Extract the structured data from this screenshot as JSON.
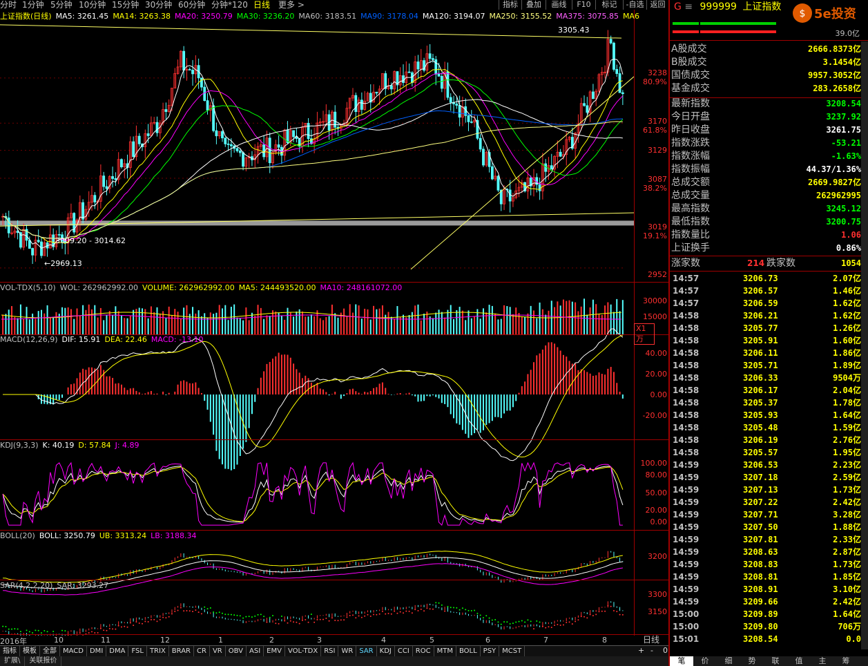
{
  "toolbar": {
    "periods": [
      "分时",
      "1分钟",
      "5分钟",
      "10分钟",
      "15分钟",
      "30分钟",
      "60分钟",
      "分钟*120",
      "日线",
      "更多 >"
    ],
    "active_period": "日线",
    "buttons": [
      "指标",
      "叠加",
      "画线",
      "F10",
      "标记",
      "-自选",
      "返回"
    ]
  },
  "main_chart": {
    "title": "上证指数(日线)",
    "ma_labels": [
      {
        "text": "MA5: 3261.45",
        "color": "#ffffff"
      },
      {
        "text": "MA14: 3263.38",
        "color": "#ffff00"
      },
      {
        "text": "MA20: 3250.79",
        "color": "#ff00ff"
      },
      {
        "text": "MA30: 3236.20",
        "color": "#00ff00"
      },
      {
        "text": "MA60: 3183.51",
        "color": "#c0c0c0"
      },
      {
        "text": "MA90: 3178.04",
        "color": "#0060ff"
      },
      {
        "text": "MA120: 3194.07",
        "color": "#ffffff"
      },
      {
        "text": "MA250: 3155.52",
        "color": "#ffff80"
      },
      {
        "text": "MA375: 3075.85",
        "color": "#ff60ff"
      },
      {
        "text": "MA6",
        "color": "#ffff00"
      }
    ],
    "annotations": [
      "3305.43",
      "3009.20 - 3014.62",
      "2969.13"
    ],
    "y_labels": [
      "3238",
      "80.9%",
      "3170",
      "61.8%",
      "3129",
      "3087",
      "38.2%",
      "3019",
      "19.1%",
      "2952"
    ]
  },
  "vol_panel": {
    "title": "VOL-TDX(5,10)",
    "labels": [
      {
        "text": "VOL-TDX(5,10)",
        "color": "#c0c0c0"
      },
      {
        "text": "WOL: 262962992.00",
        "color": "#c0c0c0"
      },
      {
        "text": "VOLUME: 262962992.00",
        "color": "#ffff00"
      },
      {
        "text": "MA5: 244493520.00",
        "color": "#ffff00"
      },
      {
        "text": "MA10: 248161072.00",
        "color": "#ff00ff"
      }
    ],
    "y_labels": [
      "30000",
      "15000",
      "X1万"
    ]
  },
  "macd_panel": {
    "labels": [
      {
        "text": "MACD(12,26,9)",
        "color": "#c0c0c0"
      },
      {
        "text": "DIF: 15.91",
        "color": "#ffffff"
      },
      {
        "text": "DEA: 22.46",
        "color": "#ffff00"
      },
      {
        "text": "MACD: -13.10",
        "color": "#ff00ff"
      }
    ],
    "y_labels": [
      "40.00",
      "20.00",
      "0.00",
      "-20.00"
    ]
  },
  "kdj_panel": {
    "labels": [
      {
        "text": "KDJ(9,3,3)",
        "color": "#c0c0c0"
      },
      {
        "text": "K: 40.19",
        "color": "#ffffff"
      },
      {
        "text": "D: 57.84",
        "color": "#ffff00"
      },
      {
        "text": "J: 4.89",
        "color": "#ff00ff"
      }
    ],
    "y_labels": [
      "100.00",
      "80.00",
      "50.00",
      "20.00",
      "0.00"
    ]
  },
  "boll_panel": {
    "labels": [
      {
        "text": "BOLL(20)",
        "color": "#c0c0c0"
      },
      {
        "text": "BOLL: 3250.79",
        "color": "#ffffff"
      },
      {
        "text": "UB: 3313.24",
        "color": "#ffff00"
      },
      {
        "text": "LB: 3188.34",
        "color": "#ff00ff"
      }
    ],
    "y_labels": [
      "3200"
    ]
  },
  "sar_panel": {
    "labels": [
      {
        "text": "SAR(4,2,2,20)",
        "color": "#c0c0c0"
      },
      {
        "text": "SAR: 3293.27",
        "color": "#c0c0c0"
      }
    ],
    "y_labels": [
      "3300",
      "3150"
    ]
  },
  "x_axis": {
    "labels": [
      "2016年",
      "10",
      "11",
      "12",
      "1",
      "2",
      "3",
      "4",
      "5",
      "6",
      "7",
      "8"
    ],
    "period_button": "日线"
  },
  "tabs": [
    "指标",
    "模板",
    "全部",
    "MACD",
    "DMI",
    "DMA",
    "FSL",
    "TRIX",
    "BRAR",
    "CR",
    "VR",
    "OBV",
    "ASI",
    "EMV",
    "VOL-TDX",
    "RSI",
    "WR",
    "SAR",
    "KDJ",
    "CCI",
    "ROC",
    "MTM",
    "BOLL",
    "PSY",
    "MCST"
  ],
  "active_tab": "SAR",
  "page_buttons": [
    "+",
    "-",
    "0"
  ],
  "bottom_bar": [
    "扩展\\",
    "关联报价"
  ],
  "right_panel": {
    "g_label": "G",
    "code": "999999",
    "name": "上证指数",
    "logo_text": "5e投资",
    "ratio": "39.0亿",
    "stats": [
      {
        "label": "A股成交",
        "value": "2666.8373亿",
        "color": "#ffff00"
      },
      {
        "label": "B股成交",
        "value": "3.1454亿",
        "color": "#ffff00"
      },
      {
        "label": "国债成交",
        "value": "9957.3052亿",
        "color": "#ffff00"
      },
      {
        "label": "基金成交",
        "value": "283.2658亿",
        "color": "#ffff00"
      }
    ],
    "quote": [
      {
        "label": "最新指数",
        "value": "3208.54",
        "color": "#00ff00"
      },
      {
        "label": "今日开盘",
        "value": "3237.92",
        "color": "#00ff00"
      },
      {
        "label": "昨日收盘",
        "value": "3261.75",
        "color": "#ffffff"
      },
      {
        "label": "指数涨跌",
        "value": "-53.21",
        "color": "#00ff00"
      },
      {
        "label": "指数涨幅",
        "value": "-1.63%",
        "color": "#00ff00"
      },
      {
        "label": "指数振幅",
        "value": "44.37/1.36%",
        "color": "#ffffff"
      },
      {
        "label": "总成交额",
        "value": "2669.9827亿",
        "color": "#ffff00"
      },
      {
        "label": "总成交量",
        "value": "262962995",
        "color": "#ffff00"
      },
      {
        "label": "最高指数",
        "value": "3245.12",
        "color": "#00ff00"
      },
      {
        "label": "最低指数",
        "value": "3200.75",
        "color": "#00ff00"
      },
      {
        "label": "指数量比",
        "value": "1.06",
        "color": "#ff3030"
      },
      {
        "label": "上证换手",
        "value": "0.86%",
        "color": "#ffffff"
      }
    ],
    "advance_label": "涨家数",
    "advance_value": "214",
    "decline_label": "跌家数",
    "decline_value": "1054",
    "ticks": [
      {
        "time": "14:57",
        "price": "3206.73",
        "vol": "2.07亿"
      },
      {
        "time": "14:57",
        "price": "3206.57",
        "vol": "1.46亿"
      },
      {
        "time": "14:57",
        "price": "3206.59",
        "vol": "1.62亿"
      },
      {
        "time": "14:58",
        "price": "3206.21",
        "vol": "1.62亿"
      },
      {
        "time": "14:58",
        "price": "3205.77",
        "vol": "1.26亿"
      },
      {
        "time": "14:58",
        "price": "3205.91",
        "vol": "1.60亿"
      },
      {
        "time": "14:58",
        "price": "3206.11",
        "vol": "1.86亿"
      },
      {
        "time": "14:58",
        "price": "3205.71",
        "vol": "1.89亿"
      },
      {
        "time": "14:58",
        "price": "3206.33",
        "vol": "9504万"
      },
      {
        "time": "14:58",
        "price": "3206.17",
        "vol": "2.04亿"
      },
      {
        "time": "14:58",
        "price": "3205.37",
        "vol": "1.78亿"
      },
      {
        "time": "14:58",
        "price": "3205.93",
        "vol": "1.64亿"
      },
      {
        "time": "14:58",
        "price": "3205.48",
        "vol": "1.59亿"
      },
      {
        "time": "14:58",
        "price": "3206.19",
        "vol": "2.76亿"
      },
      {
        "time": "14:58",
        "price": "3205.57",
        "vol": "1.95亿"
      },
      {
        "time": "14:59",
        "price": "3206.53",
        "vol": "2.23亿"
      },
      {
        "time": "14:59",
        "price": "3207.18",
        "vol": "2.59亿"
      },
      {
        "time": "14:59",
        "price": "3207.13",
        "vol": "1.73亿"
      },
      {
        "time": "14:59",
        "price": "3207.22",
        "vol": "2.42亿"
      },
      {
        "time": "14:59",
        "price": "3207.71",
        "vol": "3.28亿"
      },
      {
        "time": "14:59",
        "price": "3207.50",
        "vol": "1.88亿"
      },
      {
        "time": "14:59",
        "price": "3207.81",
        "vol": "2.33亿"
      },
      {
        "time": "14:59",
        "price": "3208.63",
        "vol": "2.87亿"
      },
      {
        "time": "14:59",
        "price": "3208.83",
        "vol": "1.73亿"
      },
      {
        "time": "14:59",
        "price": "3208.81",
        "vol": "1.85亿"
      },
      {
        "time": "14:59",
        "price": "3208.91",
        "vol": "3.10亿"
      },
      {
        "time": "14:59",
        "price": "3209.66",
        "vol": "2.42亿"
      },
      {
        "time": "15:00",
        "price": "3209.89",
        "vol": "1.64亿"
      },
      {
        "time": "15:00",
        "price": "3209.80",
        "vol": "706万"
      },
      {
        "time": "15:01",
        "price": "3208.54",
        "vol": "0.0"
      }
    ],
    "bottom_tabs": [
      "笔",
      "价",
      "细",
      "势",
      "联",
      "值",
      "主",
      "筹"
    ],
    "active_bottom_tab": "笔"
  }
}
